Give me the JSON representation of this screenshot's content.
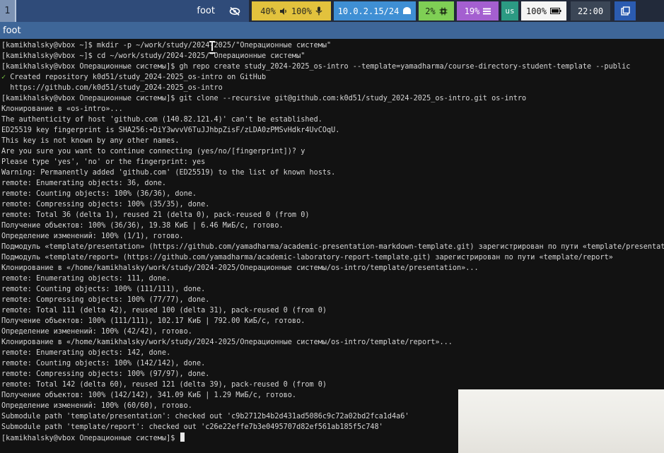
{
  "topbar": {
    "workspace": "1",
    "window_title": "foot",
    "volume": "40%",
    "mic": "100%",
    "ip": "10.0.2.15/24",
    "cpu": "2%",
    "memory": "19%",
    "layout": "us",
    "battery": "100%",
    "clock": "22:00"
  },
  "window": {
    "title": "foot"
  },
  "terminal": {
    "lines": [
      "[kamikhalsky@vbox ~]$ mkdir -p ~/work/study/2024-2025/\"Операционные системы\"",
      "[kamikhalsky@vbox ~]$ cd ~/work/study/2024-2025/\"Операционные системы\"",
      "[kamikhalsky@vbox Операционные системы]$ gh repo create study_2024-2025_os-intro --template=yamadharma/course-directory-student-template --public",
      "✓ Created repository k0d51/study_2024-2025_os-intro on GitHub",
      "  https://github.com/k0d51/study_2024-2025_os-intro",
      "[kamikhalsky@vbox Операционные системы]$ git clone --recursive git@github.com:k0d51/study_2024-2025_os-intro.git os-intro",
      "Клонирование в «os-intro»...",
      "The authenticity of host 'github.com (140.82.121.4)' can't be established.",
      "ED25519 key fingerprint is SHA256:+DiY3wvvV6TuJJhbpZisF/zLDA0zPMSvHdkr4UvCOqU.",
      "This key is not known by any other names.",
      "Are you sure you want to continue connecting (yes/no/[fingerprint])? y",
      "Please type 'yes', 'no' or the fingerprint: yes",
      "Warning: Permanently added 'github.com' (ED25519) to the list of known hosts.",
      "remote: Enumerating objects: 36, done.",
      "remote: Counting objects: 100% (36/36), done.",
      "remote: Compressing objects: 100% (35/35), done.",
      "remote: Total 36 (delta 1), reused 21 (delta 0), pack-reused 0 (from 0)",
      "Получение объектов: 100% (36/36), 19.38 КиБ | 6.46 МиБ/с, готово.",
      "Определение изменений: 100% (1/1), готово.",
      "Подмодуль «template/presentation» (https://github.com/yamadharma/academic-presentation-markdown-template.git) зарегистрирован по пути «template/presentation»",
      "Подмодуль «template/report» (https://github.com/yamadharma/academic-laboratory-report-template.git) зарегистрирован по пути «template/report»",
      "Клонирование в «/home/kamikhalsky/work/study/2024-2025/Операционные системы/os-intro/template/presentation»...",
      "remote: Enumerating objects: 111, done.",
      "remote: Counting objects: 100% (111/111), done.",
      "remote: Compressing objects: 100% (77/77), done.",
      "remote: Total 111 (delta 42), reused 100 (delta 31), pack-reused 0 (from 0)",
      "Получение объектов: 100% (111/111), 102.17 КиБ | 792.00 КиБ/с, готово.",
      "Определение изменений: 100% (42/42), готово.",
      "Клонирование в «/home/kamikhalsky/work/study/2024-2025/Операционные системы/os-intro/template/report»...",
      "remote: Enumerating objects: 142, done.",
      "remote: Counting objects: 100% (142/142), done.",
      "remote: Compressing objects: 100% (97/97), done.",
      "remote: Total 142 (delta 60), reused 121 (delta 39), pack-reused 0 (from 0)",
      "Получение объектов: 100% (142/142), 341.09 КиБ | 1.29 МиБ/с, готово.",
      "Определение изменений: 100% (60/60), готово.",
      "Submodule path 'template/presentation': checked out 'c9b2712b4b2d431ad5086c9c72a02bd2fca1d4a6'",
      "Submodule path 'template/report': checked out 'c26e22effe7b3e0495707d82ef561ab185f5c748'"
    ],
    "prompt": "[kamikhalsky@vbox Операционные системы]$ "
  },
  "icons": {
    "eye": "eye-off-icon",
    "volume": "speaker-icon",
    "mic": "microphone-icon",
    "network": "ethernet-icon",
    "cpu": "chip-icon",
    "memory": "memory-icon",
    "battery": "battery-icon",
    "tray": "tray-icon"
  },
  "colors": {
    "bar": "#222a3a",
    "focused_title": "#2f4b79",
    "volume": "#e2c23d",
    "network": "#3f8fd4",
    "cpu": "#7fcf55",
    "memory": "#a45fd0",
    "lang": "#2c9a83",
    "terminal_bg": "#121212",
    "window_header": "#3e6698"
  }
}
